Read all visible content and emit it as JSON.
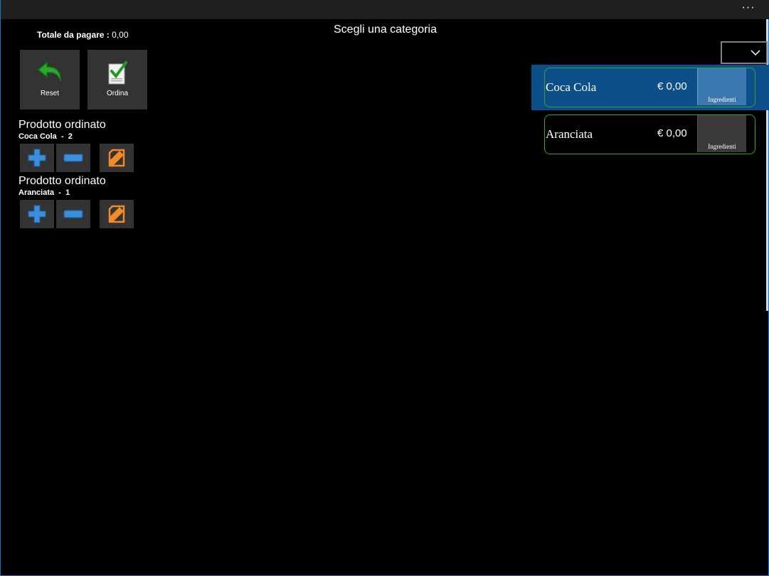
{
  "window": {
    "more_label": "···"
  },
  "header": {
    "total_label": "Totale da pagare :",
    "total_value": "0,00",
    "title": "Scegli una categoria"
  },
  "actions": {
    "reset_label": "Reset",
    "ordina_label": "Ordina"
  },
  "orders": [
    {
      "title": "Prodotto ordinato",
      "name": "Coca Cola",
      "sep": "-",
      "qty": "2"
    },
    {
      "title": "Prodotto ordinato",
      "name": "Aranciata",
      "sep": "-",
      "qty": "1"
    }
  ],
  "category_select": {
    "selected": ""
  },
  "products": [
    {
      "name": "Coca Cola",
      "price": "€ 0,00",
      "ingredients_label": "Ingredienti",
      "selected": true
    },
    {
      "name": "Aranciata",
      "price": "€ 0,00",
      "ingredients_label": "Ingredienti",
      "selected": false
    }
  ],
  "colors": {
    "background": "#000000",
    "titlebar": "#1f1f1f",
    "tile": "#333333",
    "selection": "#0d4f8b",
    "product_border": "#2fa82f",
    "reset_arrow": "#2fa82f",
    "plus_minus": "#3a8fdc",
    "edit_icon": "#f08a2a"
  },
  "icons": [
    "undo-arrow-icon",
    "checklist-icon",
    "plus-icon",
    "minus-icon",
    "edit-note-icon",
    "chevron-down-icon"
  ]
}
